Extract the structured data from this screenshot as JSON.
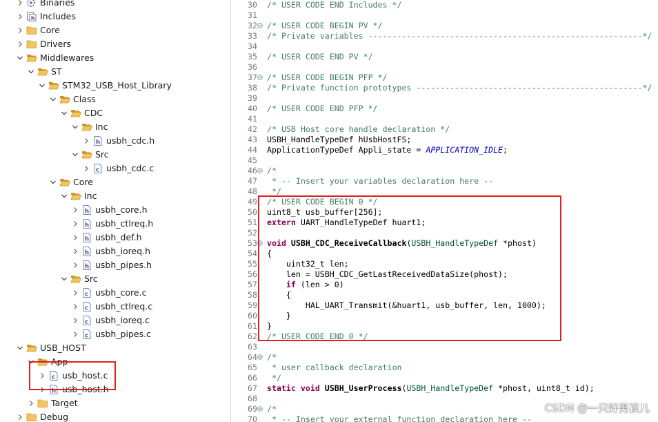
{
  "explorer": {
    "items": [
      {
        "label": "Binaries",
        "depth": 1,
        "expanded": false,
        "kind": "binaries"
      },
      {
        "label": "Includes",
        "depth": 1,
        "expanded": false,
        "kind": "includes"
      },
      {
        "label": "Core",
        "depth": 1,
        "expanded": false,
        "kind": "folder"
      },
      {
        "label": "Drivers",
        "depth": 1,
        "expanded": false,
        "kind": "folder"
      },
      {
        "label": "Middlewares",
        "depth": 1,
        "expanded": true,
        "kind": "folder"
      },
      {
        "label": "ST",
        "depth": 2,
        "expanded": true,
        "kind": "folder"
      },
      {
        "label": "STM32_USB_Host_Library",
        "depth": 3,
        "expanded": true,
        "kind": "folder"
      },
      {
        "label": "Class",
        "depth": 4,
        "expanded": true,
        "kind": "folder"
      },
      {
        "label": "CDC",
        "depth": 5,
        "expanded": true,
        "kind": "folder"
      },
      {
        "label": "Inc",
        "depth": 6,
        "expanded": true,
        "kind": "folder"
      },
      {
        "label": "usbh_cdc.h",
        "depth": 7,
        "expanded": false,
        "kind": "h"
      },
      {
        "label": "Src",
        "depth": 6,
        "expanded": true,
        "kind": "folder"
      },
      {
        "label": "usbh_cdc.c",
        "depth": 7,
        "expanded": false,
        "kind": "c"
      },
      {
        "label": "Core",
        "depth": 4,
        "expanded": true,
        "kind": "folder"
      },
      {
        "label": "Inc",
        "depth": 5,
        "expanded": true,
        "kind": "folder"
      },
      {
        "label": "usbh_core.h",
        "depth": 6,
        "expanded": false,
        "kind": "h"
      },
      {
        "label": "usbh_ctlreq.h",
        "depth": 6,
        "expanded": false,
        "kind": "h"
      },
      {
        "label": "usbh_def.h",
        "depth": 6,
        "expanded": false,
        "kind": "h"
      },
      {
        "label": "usbh_ioreq.h",
        "depth": 6,
        "expanded": false,
        "kind": "h"
      },
      {
        "label": "usbh_pipes.h",
        "depth": 6,
        "expanded": false,
        "kind": "h"
      },
      {
        "label": "Src",
        "depth": 5,
        "expanded": true,
        "kind": "folder"
      },
      {
        "label": "usbh_core.c",
        "depth": 6,
        "expanded": false,
        "kind": "c"
      },
      {
        "label": "usbh_ctlreq.c",
        "depth": 6,
        "expanded": false,
        "kind": "c"
      },
      {
        "label": "usbh_ioreq.c",
        "depth": 6,
        "expanded": false,
        "kind": "c"
      },
      {
        "label": "usbh_pipes.c",
        "depth": 6,
        "expanded": false,
        "kind": "c"
      },
      {
        "label": "USB_HOST",
        "depth": 1,
        "expanded": true,
        "kind": "folder"
      },
      {
        "label": "App",
        "depth": 2,
        "expanded": true,
        "kind": "folder"
      },
      {
        "label": "usb_host.c",
        "depth": 3,
        "expanded": false,
        "kind": "c"
      },
      {
        "label": "usb_host.h",
        "depth": 3,
        "expanded": false,
        "kind": "h"
      },
      {
        "label": "Target",
        "depth": 2,
        "expanded": false,
        "kind": "folder"
      },
      {
        "label": "Debug",
        "depth": 1,
        "expanded": false,
        "kind": "folder"
      }
    ]
  },
  "editor": {
    "lines": [
      {
        "n": "30",
        "fold": false,
        "tokens": [
          [
            "cm",
            "/* USER CODE END Includes */"
          ]
        ]
      },
      {
        "n": "31",
        "fold": false,
        "tokens": []
      },
      {
        "n": "32",
        "fold": true,
        "tokens": [
          [
            "cm",
            "/* USER CODE BEGIN PV */"
          ]
        ]
      },
      {
        "n": "33",
        "fold": false,
        "tokens": [
          [
            "cm",
            "/* Private variables ---------------------------------------------------------*/"
          ]
        ]
      },
      {
        "n": "34",
        "fold": false,
        "tokens": []
      },
      {
        "n": "35",
        "fold": false,
        "tokens": [
          [
            "cm",
            "/* USER CODE END PV */"
          ]
        ]
      },
      {
        "n": "36",
        "fold": false,
        "tokens": []
      },
      {
        "n": "37",
        "fold": true,
        "tokens": [
          [
            "cm",
            "/* USER CODE BEGIN PFP */"
          ]
        ]
      },
      {
        "n": "38",
        "fold": false,
        "tokens": [
          [
            "cm",
            "/* Private function prototypes -----------------------------------------------*/"
          ]
        ]
      },
      {
        "n": "39",
        "fold": false,
        "tokens": []
      },
      {
        "n": "40",
        "fold": false,
        "tokens": [
          [
            "cm",
            "/* USER CODE END PFP */"
          ]
        ]
      },
      {
        "n": "41",
        "fold": false,
        "tokens": []
      },
      {
        "n": "42",
        "fold": false,
        "tokens": [
          [
            "cm",
            "/* USB Host core handle declaration */"
          ]
        ]
      },
      {
        "n": "43",
        "fold": false,
        "tokens": [
          [
            "pl",
            "USBH_HandleTypeDef hUsbHostFS;"
          ]
        ]
      },
      {
        "n": "44",
        "fold": false,
        "tokens": [
          [
            "pl",
            "ApplicationTypeDef Appli_state = "
          ],
          [
            "it",
            "APPLICATION_IDLE"
          ],
          [
            "pl",
            ";"
          ]
        ]
      },
      {
        "n": "45",
        "fold": false,
        "tokens": []
      },
      {
        "n": "46",
        "fold": true,
        "tokens": [
          [
            "cm",
            "/*"
          ]
        ]
      },
      {
        "n": "47",
        "fold": false,
        "tokens": [
          [
            "cm",
            " * -- Insert your variables declaration here --"
          ]
        ]
      },
      {
        "n": "48",
        "fold": false,
        "tokens": [
          [
            "cm",
            " */"
          ]
        ]
      },
      {
        "n": "49",
        "fold": false,
        "tokens": [
          [
            "cm",
            "/* USER CODE BEGIN 0 */"
          ]
        ]
      },
      {
        "n": "50",
        "fold": false,
        "tokens": [
          [
            "pl",
            "uint8_t usb_buffer[256];"
          ]
        ]
      },
      {
        "n": "51",
        "fold": false,
        "tokens": [
          [
            "kw",
            "extern"
          ],
          [
            "pl",
            " UART_HandleTypeDef huart1;"
          ]
        ]
      },
      {
        "n": "52",
        "fold": false,
        "tokens": []
      },
      {
        "n": "53",
        "fold": true,
        "tokens": [
          [
            "kw",
            "void"
          ],
          [
            "pl",
            " "
          ],
          [
            "fn",
            "USBH_CDC_ReceiveCallback"
          ],
          [
            "pl",
            "("
          ],
          [
            "ty",
            "USBH_HandleTypeDef"
          ],
          [
            "pl",
            " *phost)"
          ]
        ]
      },
      {
        "n": "54",
        "fold": false,
        "tokens": [
          [
            "pl",
            "{"
          ]
        ]
      },
      {
        "n": "55",
        "fold": false,
        "tokens": [
          [
            "pl",
            "    uint32_t len;"
          ]
        ]
      },
      {
        "n": "56",
        "fold": false,
        "tokens": [
          [
            "pl",
            "    len = USBH_CDC_GetLastReceivedDataSize(phost);"
          ]
        ]
      },
      {
        "n": "57",
        "fold": false,
        "tokens": [
          [
            "pl",
            "    "
          ],
          [
            "kw",
            "if"
          ],
          [
            "pl",
            " (len > 0)"
          ]
        ]
      },
      {
        "n": "58",
        "fold": false,
        "tokens": [
          [
            "pl",
            "    {"
          ]
        ]
      },
      {
        "n": "59",
        "fold": false,
        "tokens": [
          [
            "pl",
            "        HAL_UART_Transmit(&huart1, usb_buffer, len, 1000);"
          ]
        ]
      },
      {
        "n": "60",
        "fold": false,
        "tokens": [
          [
            "pl",
            "    }"
          ]
        ]
      },
      {
        "n": "61",
        "fold": false,
        "tokens": [
          [
            "pl",
            "}"
          ]
        ]
      },
      {
        "n": "62",
        "fold": false,
        "tokens": [
          [
            "cm",
            "/* USER CODE END 0 */"
          ]
        ]
      },
      {
        "n": "63",
        "fold": false,
        "tokens": []
      },
      {
        "n": "64",
        "fold": true,
        "tokens": [
          [
            "cm",
            "/*"
          ]
        ]
      },
      {
        "n": "65",
        "fold": false,
        "tokens": [
          [
            "cm",
            " * user callback declaration"
          ]
        ]
      },
      {
        "n": "66",
        "fold": false,
        "tokens": [
          [
            "cm",
            " */"
          ]
        ]
      },
      {
        "n": "67",
        "fold": false,
        "tokens": [
          [
            "kw",
            "static"
          ],
          [
            "pl",
            " "
          ],
          [
            "kw",
            "void"
          ],
          [
            "pl",
            " "
          ],
          [
            "fn",
            "USBH_UserProcess"
          ],
          [
            "pl",
            "("
          ],
          [
            "ty",
            "USBH_HandleTypeDef"
          ],
          [
            "pl",
            " *phost, uint8_t id);"
          ]
        ]
      },
      {
        "n": "68",
        "fold": false,
        "tokens": []
      },
      {
        "n": "69",
        "fold": true,
        "tokens": [
          [
            "cm",
            "/*"
          ]
        ]
      },
      {
        "n": "70",
        "fold": false,
        "tokens": [
          [
            "cm",
            " * -- Insert your external function declaration here --"
          ]
        ]
      }
    ]
  },
  "watermark": "CSDN @一只好男孩儿",
  "colors": {
    "highlight": "#e0201c",
    "comment": "#3f7f5f",
    "keyword": "#7f0055",
    "folder": "#e8b84a"
  }
}
